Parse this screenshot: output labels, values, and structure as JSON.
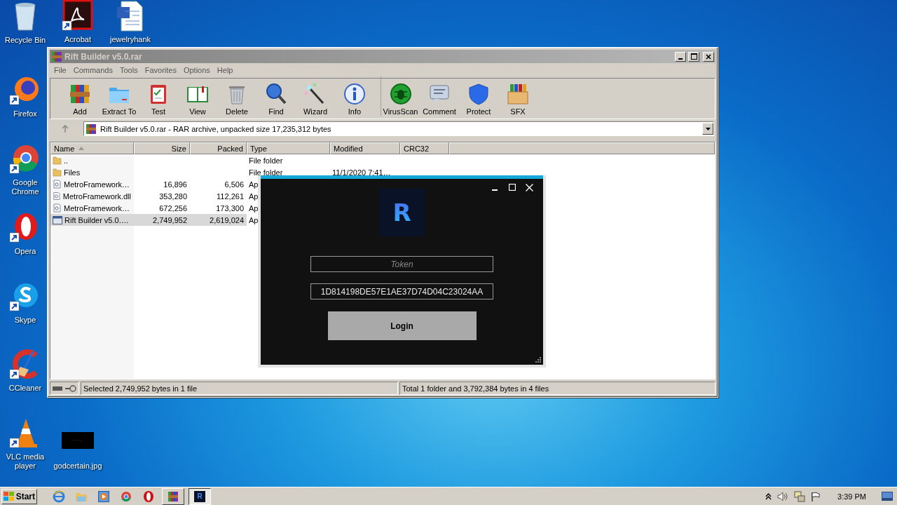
{
  "desktop_icons": [
    {
      "label": "Recycle Bin"
    },
    {
      "label": "Acrobat"
    },
    {
      "label": "jewelryhank"
    },
    {
      "label": "Firefox"
    },
    {
      "label": "Google Chrome"
    },
    {
      "label": "Opera"
    },
    {
      "label": "Skype"
    },
    {
      "label": "CCleaner"
    },
    {
      "label": "VLC media player"
    },
    {
      "label": "godcertain.jpg"
    }
  ],
  "winrar": {
    "title": "Rift Builder v5.0.rar",
    "menu": [
      "File",
      "Commands",
      "Tools",
      "Favorites",
      "Options",
      "Help"
    ],
    "toolbar": [
      {
        "label": "Add"
      },
      {
        "label": "Extract To"
      },
      {
        "label": "Test"
      },
      {
        "label": "View"
      },
      {
        "label": "Delete"
      },
      {
        "label": "Find"
      },
      {
        "label": "Wizard"
      },
      {
        "label": "Info"
      },
      {
        "label": "VirusScan",
        "group_start": true
      },
      {
        "label": "Comment"
      },
      {
        "label": "Protect"
      },
      {
        "label": "SFX"
      }
    ],
    "address": "Rift Builder v5.0.rar - RAR archive, unpacked size 17,235,312 bytes",
    "columns": [
      {
        "label": "Name",
        "sorted": true
      },
      {
        "label": "Size",
        "sorted": false
      },
      {
        "label": "Packed",
        "sorted": false
      },
      {
        "label": "Type",
        "sorted": false
      },
      {
        "label": "Modified",
        "sorted": false
      },
      {
        "label": "CRC32",
        "sorted": false
      }
    ],
    "rows": [
      {
        "kind": "folder",
        "name": "..",
        "type": "File folder",
        "selected": false
      },
      {
        "kind": "folder",
        "name": "Files",
        "type": "File folder",
        "modified": "11/1/2020 7:41…",
        "selected": false
      },
      {
        "kind": "dll",
        "name": "MetroFramework…",
        "size": "16,896",
        "packed": "6,506",
        "type": "Ap",
        "selected": false
      },
      {
        "kind": "dll",
        "name": "MetroFramework.dll",
        "size": "353,280",
        "packed": "112,261",
        "type": "Ap",
        "selected": false
      },
      {
        "kind": "dll",
        "name": "MetroFramework…",
        "size": "672,256",
        "packed": "173,300",
        "type": "Ap",
        "selected": false
      },
      {
        "kind": "exe",
        "name": "Rift Builder v5.0.…",
        "size": "2,749,952",
        "packed": "2,619,024",
        "type": "Ap",
        "selected": true
      }
    ],
    "status_left": "Selected 2,749,952 bytes in 1 file",
    "status_right": "Total 1 folder and 3,792,384 bytes in 4 files"
  },
  "login": {
    "logo_letter": "R",
    "token": {
      "placeholder": "Token"
    },
    "key": {
      "value": "1D814198DE57E1AE37D74D04C23024AA"
    },
    "button": "Login"
  },
  "taskbar": {
    "start": "Start",
    "tasks": [
      {
        "kind": "winrar",
        "selected": false
      },
      {
        "kind": "app",
        "label": "R",
        "selected": true
      }
    ],
    "clock": "3:39 PM"
  }
}
